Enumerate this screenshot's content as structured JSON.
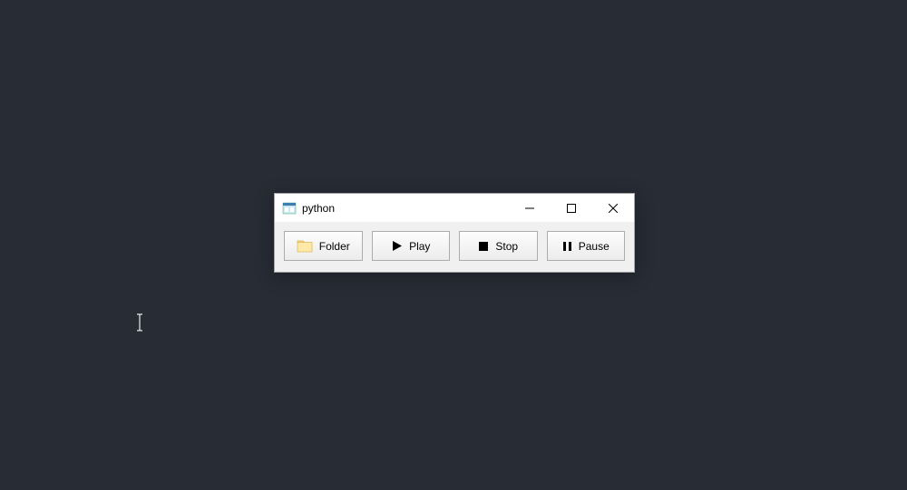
{
  "window": {
    "title": "python"
  },
  "toolbar": {
    "folder_label": "Folder",
    "play_label": "Play",
    "stop_label": "Stop",
    "pause_label": "Pause"
  }
}
